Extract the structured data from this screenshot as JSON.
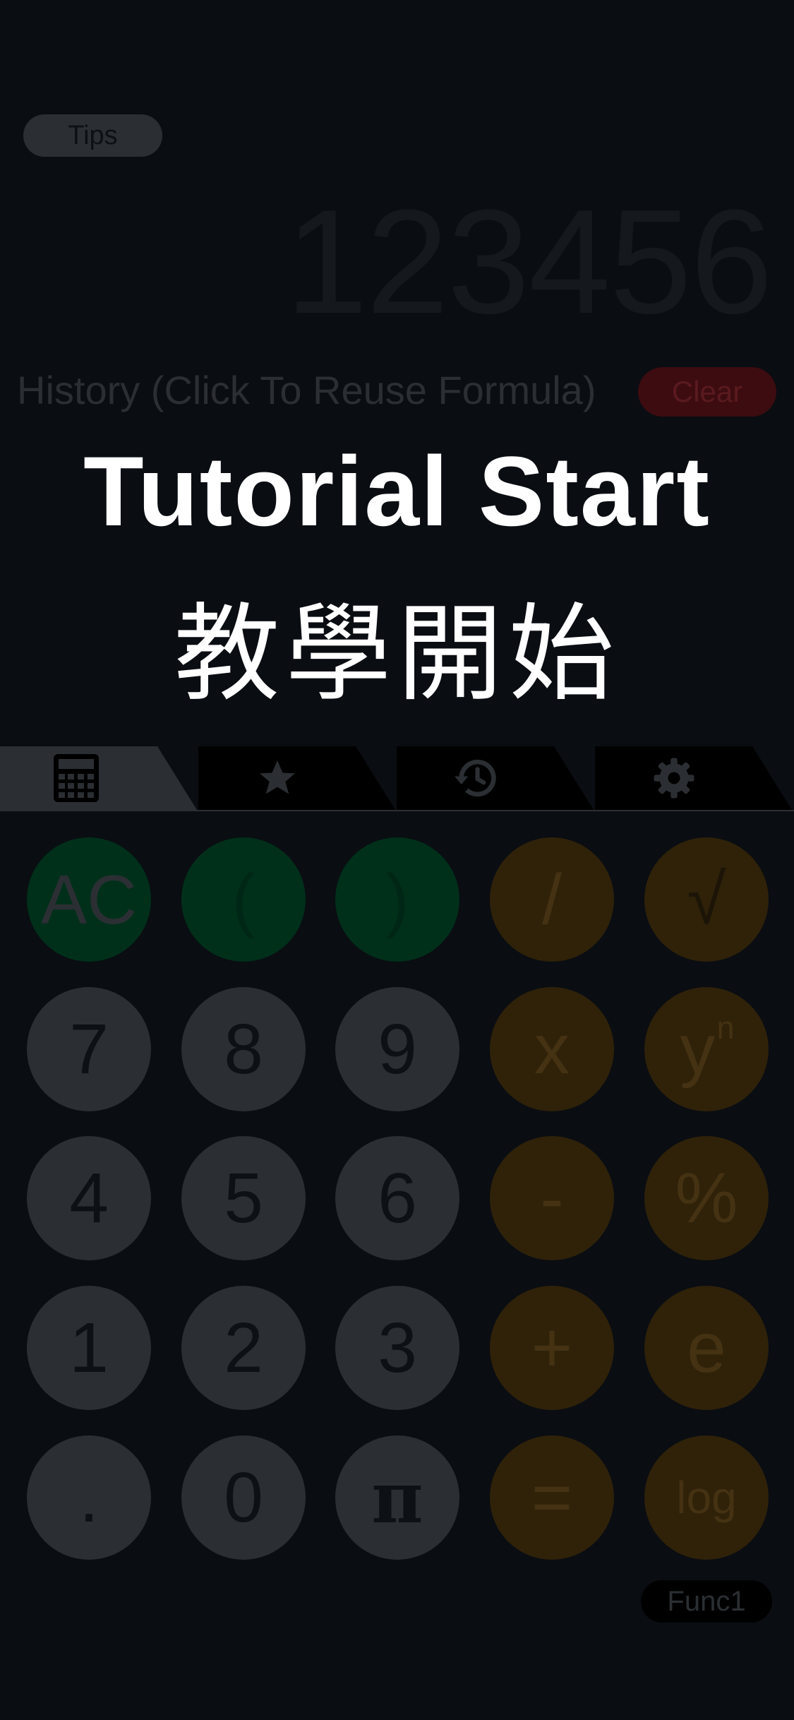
{
  "tips_label": "Tips",
  "display_value": "123456",
  "history_label": "History (Click To Reuse Formula)",
  "clear_label": "Clear",
  "overlay": {
    "title_en": "Tutorial Start",
    "title_zh": "教學開始"
  },
  "tabs": [
    {
      "icon": "calculator-icon",
      "active": true
    },
    {
      "icon": "star-icon",
      "active": false
    },
    {
      "icon": "history-icon",
      "active": false
    },
    {
      "icon": "gear-icon",
      "active": false
    }
  ],
  "keys": {
    "ac": "AC",
    "lparen": "(",
    "rparen": ")",
    "divide": "/",
    "sqrt": "√",
    "k7": "7",
    "k8": "8",
    "k9": "9",
    "multiply": "x",
    "power_base": "y",
    "power_exp": "n",
    "k4": "4",
    "k5": "5",
    "k6": "6",
    "minus": "-",
    "percent": "%",
    "k1": "1",
    "k2": "2",
    "k3": "3",
    "plus": "+",
    "e": "e",
    "dot": ".",
    "k0": "0",
    "pi": "π",
    "equals": "=",
    "log": "log"
  },
  "func_label": "Func1",
  "colors": {
    "background": "#0a0d12",
    "green": "#00301a",
    "gray": "#2b2f33",
    "orange": "#2f2209",
    "clear": "#3c0c10"
  }
}
